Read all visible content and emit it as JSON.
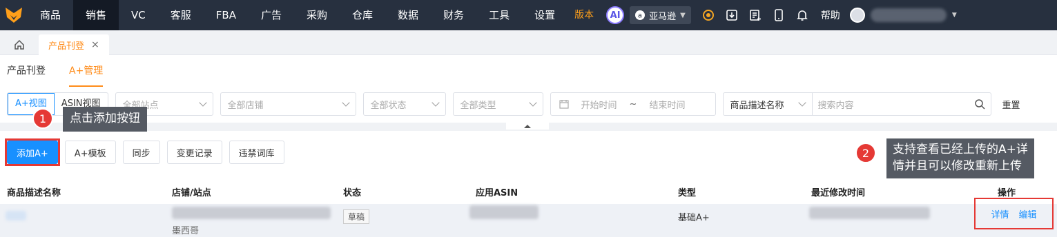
{
  "topnav": {
    "items": [
      "商品",
      "销售",
      "VC",
      "客服",
      "FBA",
      "广告",
      "采购",
      "仓库",
      "数据",
      "财务",
      "工具",
      "设置"
    ],
    "active_index": 1,
    "version_label": "版本",
    "ai_label": "AI",
    "site_label": "亚马逊",
    "help_label": "帮助"
  },
  "tabs": {
    "page_tab_label": "产品刊登",
    "close_glyph": "×"
  },
  "subtabs": [
    "产品刊登",
    "A+管理"
  ],
  "subtab_active_index": 1,
  "filters": {
    "view_options": [
      "A+视图",
      "ASIN视图"
    ],
    "site_placeholder": "全部站点",
    "store_placeholder": "全部店铺",
    "status_placeholder": "全部状态",
    "type_placeholder": "全部类型",
    "start_time": "开始时间",
    "tilde": "~",
    "end_time": "结束时间",
    "search_field": "商品描述名称",
    "search_placeholder": "搜索内容",
    "reset_label": "重置"
  },
  "actions": {
    "add": "添加A+",
    "template": "A+模板",
    "sync": "同步",
    "change_log": "变更记录",
    "banned_words": "违禁词库"
  },
  "table": {
    "headers": [
      "商品描述名称",
      "店铺/站点",
      "状态",
      "应用ASIN",
      "类型",
      "最近修改时间",
      "操作"
    ],
    "rows": [
      {
        "site": "墨西哥",
        "status": "草稿",
        "type": "基础A+",
        "ops": [
          "详情",
          "编辑"
        ]
      }
    ]
  },
  "annotations": {
    "step1_number": "1",
    "step1_text": "点击添加按钮",
    "step2_number": "2",
    "step2_line1": "支持查看已经上传的A+详",
    "step2_line2": "情并且可以修改重新上传"
  },
  "colors": {
    "topbar": "#27303f",
    "accent_orange": "#ff8c1a",
    "primary_blue": "#1890ff",
    "highlight_red": "#e53935"
  }
}
